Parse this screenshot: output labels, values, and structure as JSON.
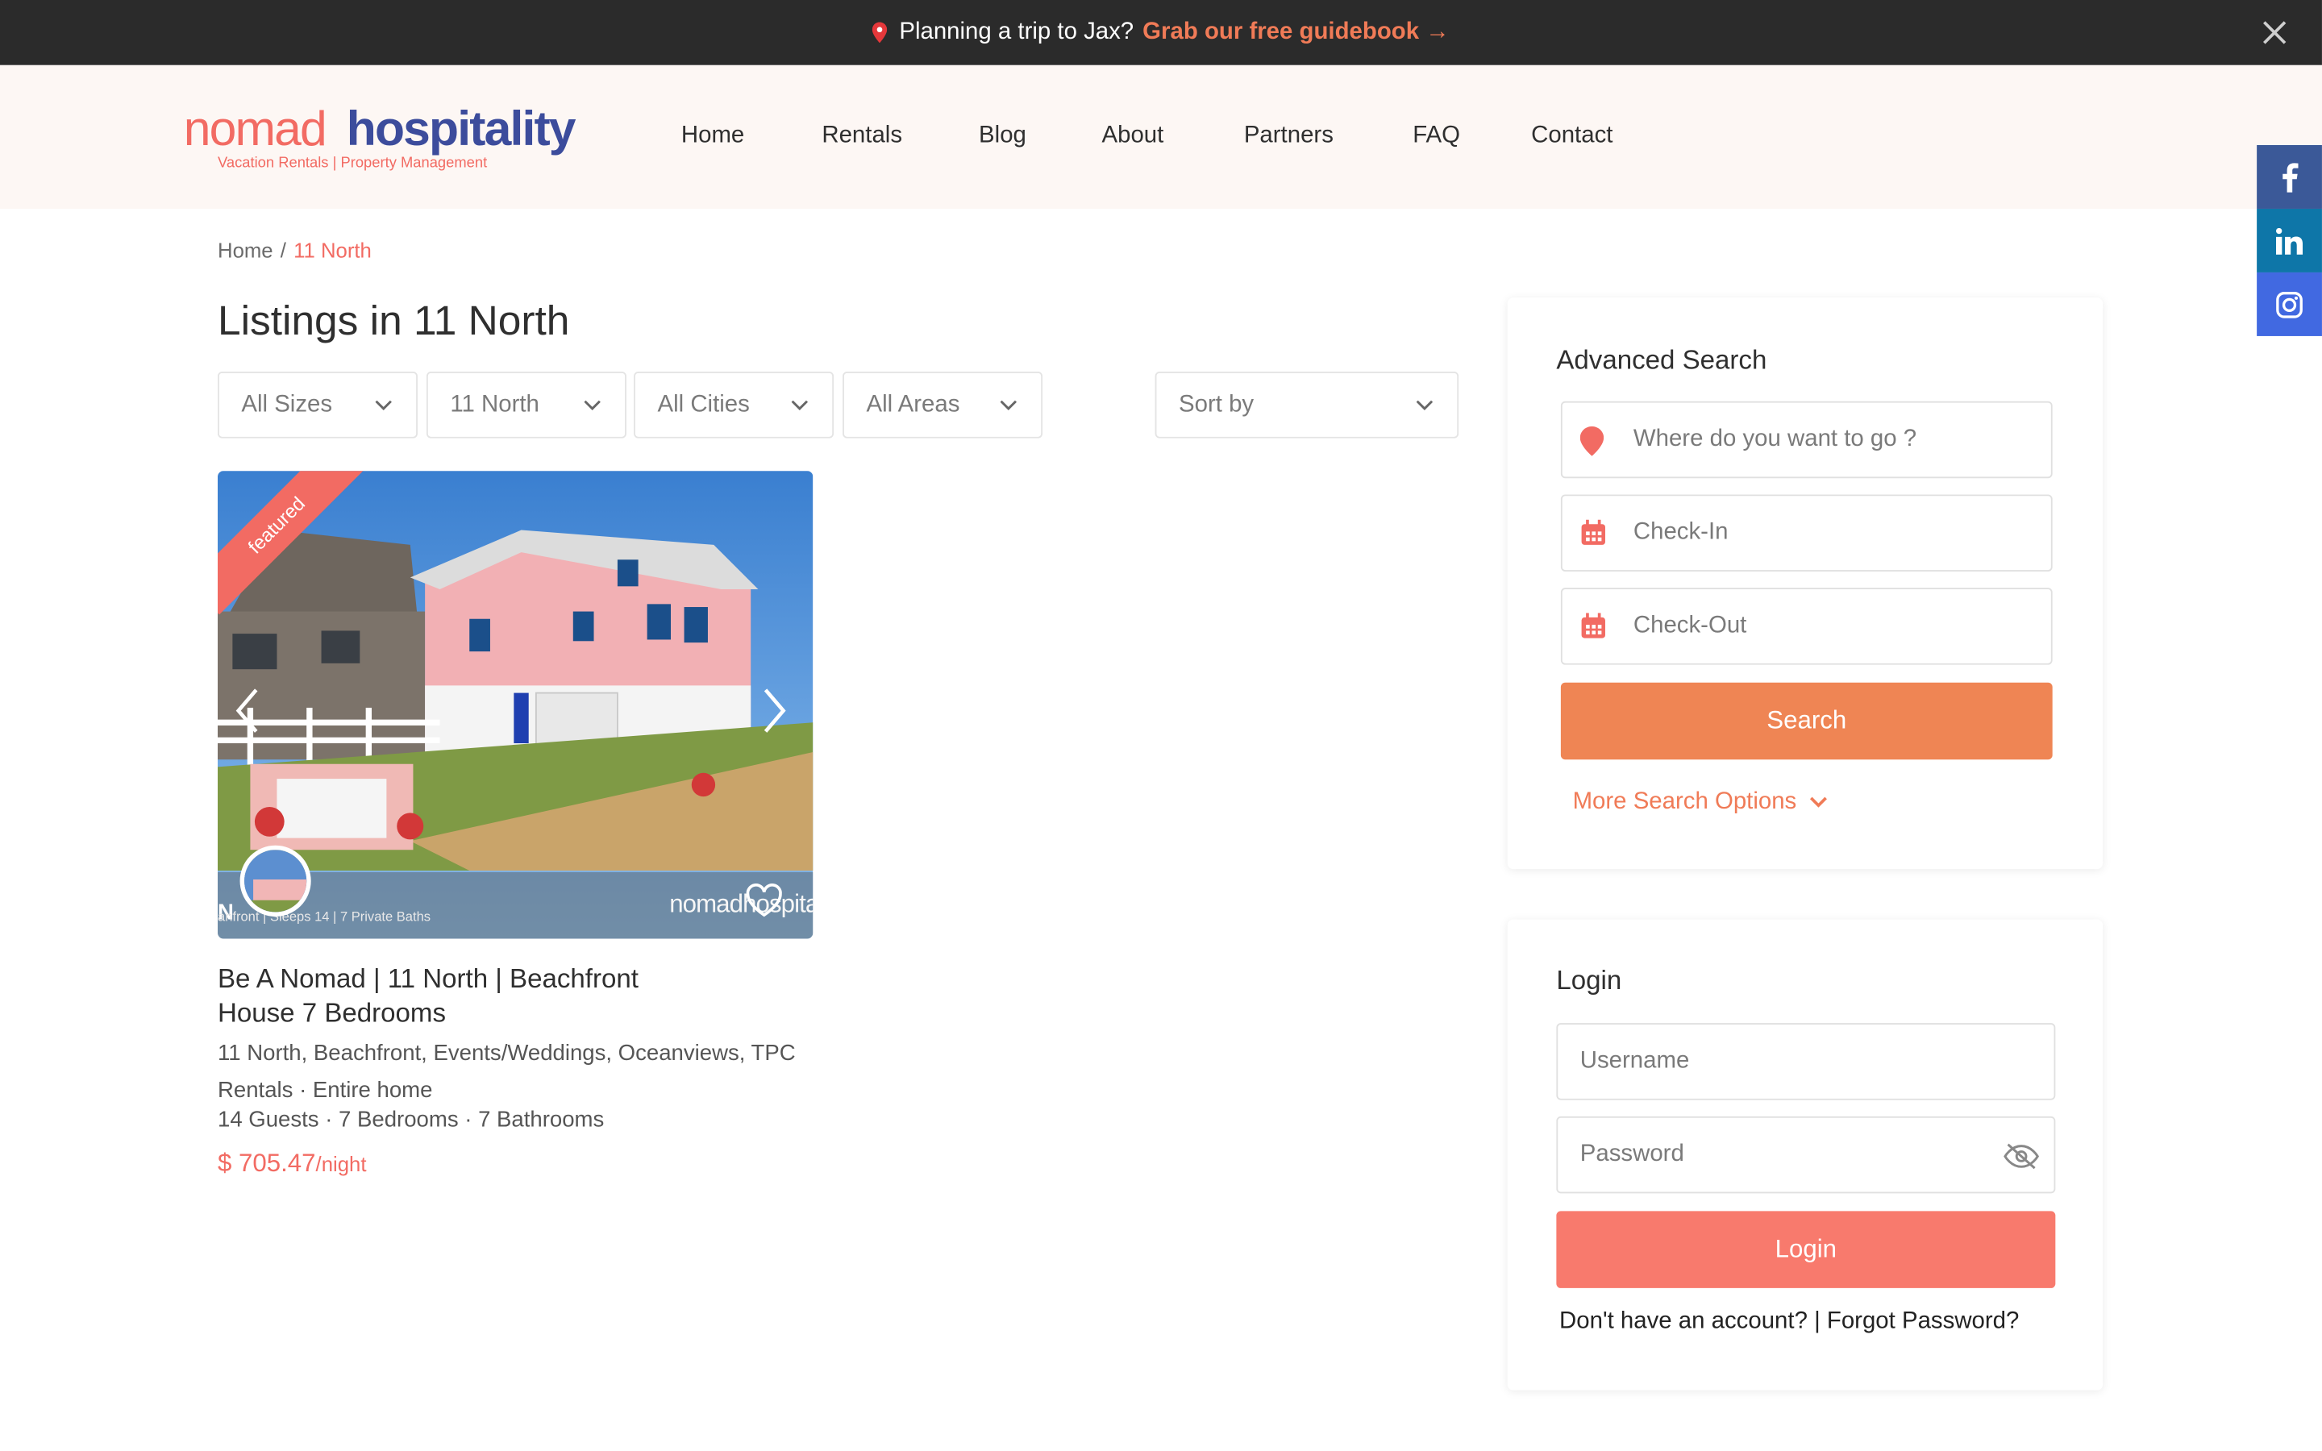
{
  "announcement": {
    "text": "Planning a trip to Jax?",
    "link": "Grab our free guidebook →"
  },
  "logo": {
    "part1": "nomad",
    "part2": "hospitality",
    "tagline": "Vacation Rentals | Property Management"
  },
  "nav": [
    "Home",
    "Rentals",
    "Blog",
    "About",
    "Partners",
    "FAQ",
    "Contact"
  ],
  "breadcrumb": {
    "home": "Home",
    "sep": "/",
    "current": "11 North"
  },
  "page_title": "Listings in 11 North",
  "filters": {
    "sizes": "All Sizes",
    "community": "11 North",
    "cities": "All Cities",
    "areas": "All Areas",
    "sort": "Sort by"
  },
  "listing": {
    "badge": "featured",
    "title": "Be A Nomad | 11 North | Beachfront House 7 Bedrooms",
    "categories": "11 North, Beachfront, Events/Weddings, Oceanviews, TPC Rentals · Entire home",
    "details": "14 Guests · 7 Bedrooms · 7 Bathrooms",
    "price": "$ 705.47",
    "per": "/night",
    "img_strip_letter": "N",
    "img_strip_sub": "anfront | Sleeps 14 | 7 Private Baths",
    "img_strip_logo": "nomadhospita"
  },
  "search": {
    "title": "Advanced Search",
    "where_placeholder": "Where do you want to go ?",
    "checkin_placeholder": "Check-In",
    "checkout_placeholder": "Check-Out",
    "button": "Search",
    "more": "More Search Options"
  },
  "login": {
    "title": "Login",
    "username_placeholder": "Username",
    "password_placeholder": "Password",
    "button": "Login",
    "register": "Don't have an account?",
    "sep": " | ",
    "forgot": "Forgot Password?"
  },
  "colors": {
    "accent": "#f26b63",
    "search_button": "#ef8554",
    "login_button": "#f87a6d",
    "facebook": "#3b5998",
    "linkedin": "#0e76a8",
    "instagram": "#4169e1"
  }
}
